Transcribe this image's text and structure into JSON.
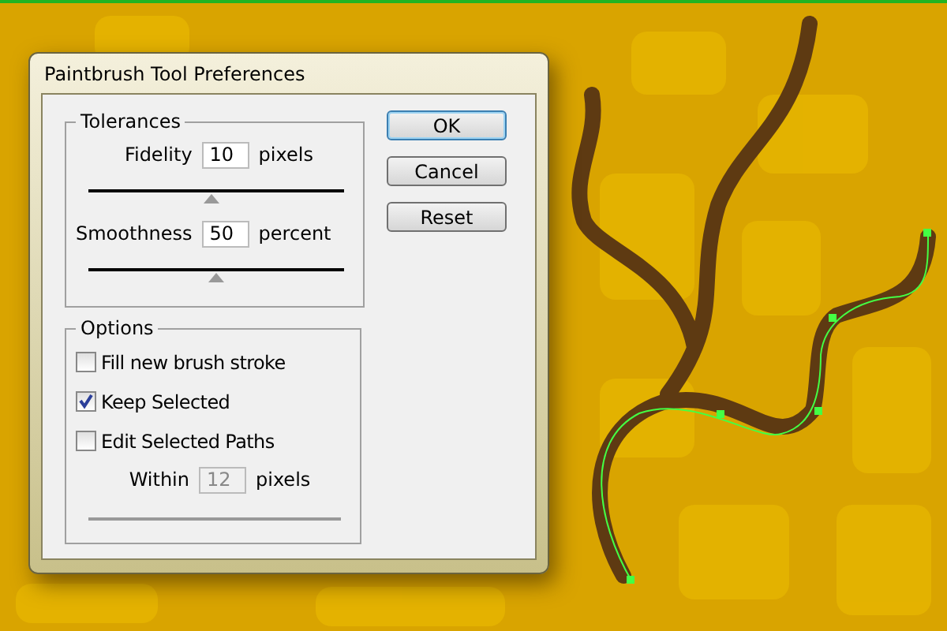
{
  "dialog": {
    "title": "Paintbrush Tool Preferences",
    "tolerances": {
      "legend": "Tolerances",
      "rows": [
        {
          "label": "Fidelity",
          "value": "10",
          "unit": "pixels",
          "level": 0.48
        },
        {
          "label": "Smoothness",
          "value": "50",
          "unit": "percent",
          "level": 0.5
        }
      ]
    },
    "options": {
      "legend": "Options",
      "checkboxes": [
        {
          "label": "Fill new brush stroke",
          "checked": false
        },
        {
          "label": "Keep Selected",
          "checked": true
        },
        {
          "label": "Edit Selected Paths",
          "checked": false
        }
      ],
      "within": {
        "label": "Within",
        "value": "12",
        "unit": "pixels",
        "disabled": true
      }
    },
    "buttons": [
      {
        "label": "OK",
        "default": true
      },
      {
        "label": "Cancel",
        "default": false
      },
      {
        "label": "Reset",
        "default": false
      }
    ]
  }
}
